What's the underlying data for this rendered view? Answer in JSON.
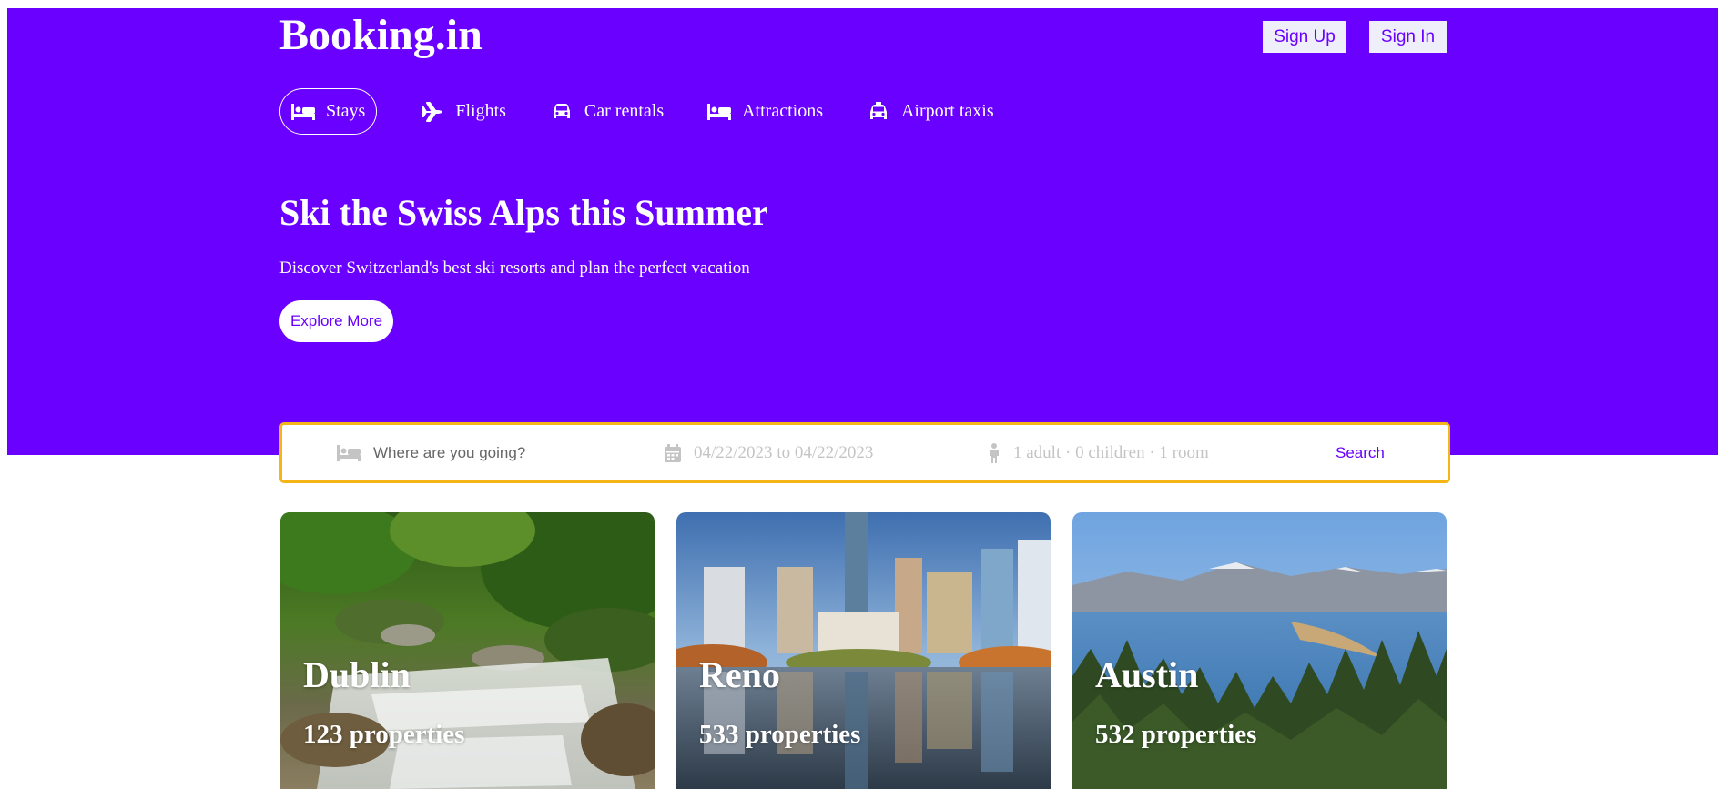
{
  "brand": {
    "logo": "Booking.in",
    "primary_color": "#6a00ff",
    "accent_border": "#f5b517"
  },
  "auth": {
    "sign_up": "Sign Up",
    "sign_in": "Sign In"
  },
  "nav": [
    {
      "label": "Stays",
      "icon": "bed-icon",
      "active": true
    },
    {
      "label": "Flights",
      "icon": "plane-icon",
      "active": false
    },
    {
      "label": "Car rentals",
      "icon": "car-icon",
      "active": false
    },
    {
      "label": "Attractions",
      "icon": "bed-icon",
      "active": false
    },
    {
      "label": "Airport taxis",
      "icon": "taxi-icon",
      "active": false
    }
  ],
  "hero": {
    "title": "Ski the Swiss Alps this Summer",
    "subtitle": "Discover Switzerland's best ski resorts and plan the perfect vacation",
    "cta": "Explore More"
  },
  "search": {
    "destination_placeholder": "Where are you going?",
    "dates": "04/22/2023 to 04/22/2023",
    "guests": "1 adult · 0 children · 1 room",
    "button": "Search"
  },
  "destinations": [
    {
      "city": "Dublin",
      "properties": "123 properties",
      "image": "waterfall-forest"
    },
    {
      "city": "Reno",
      "properties": "533 properties",
      "image": "city-skyline"
    },
    {
      "city": "Austin",
      "properties": "532 properties",
      "image": "lake-mountains"
    }
  ]
}
